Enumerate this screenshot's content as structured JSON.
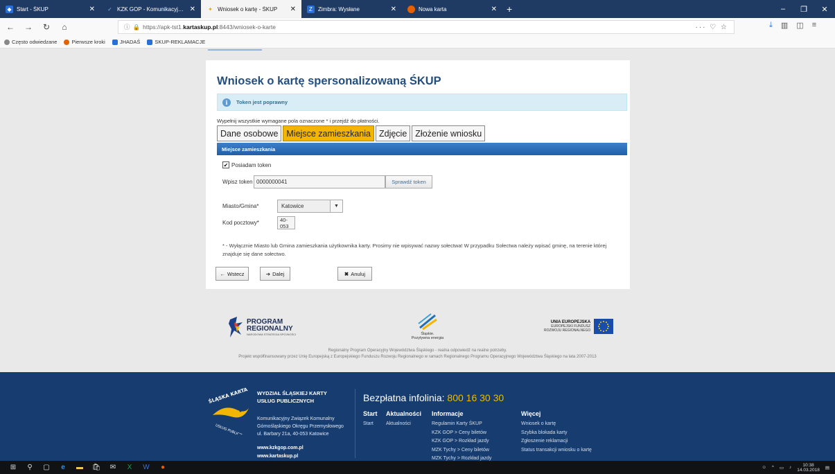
{
  "browser": {
    "tabs": [
      {
        "title": "Start - ŚKUP",
        "icon": "skup-icon",
        "active": false
      },
      {
        "title": "KZK GOP - Komunikacyjny Zw",
        "icon": "kzk-icon",
        "active": false
      },
      {
        "title": "Wniosek o kartę - ŚKUP",
        "icon": "skup-icon",
        "active": true
      },
      {
        "title": "Zimbra: Wysłane",
        "icon": "zimbra-icon",
        "active": false
      },
      {
        "title": "Nowa karta",
        "icon": "firefox-icon",
        "active": false
      }
    ],
    "new_tab": "+",
    "url_prefix": "https://apk-tst1.",
    "url_domain": "kartaskup.pl",
    "url_suffix": ":8443/wniosek-o-karte",
    "url_actions": "··· ♡ ☆",
    "bookmarks": [
      {
        "label": "Często odwiedzane",
        "color": "#888888"
      },
      {
        "label": "Pierwsze kroki",
        "color": "#e66000"
      },
      {
        "label": "JHADAŚ",
        "color": "#2a6fd6"
      },
      {
        "label": "SKUP-REKLAMACJE",
        "color": "#2a6fd6"
      }
    ]
  },
  "form": {
    "title": "Wniosek o kartę spersonalizowaną ŚKUP",
    "alert": "Token jest poprawny",
    "hint": "Wypełnij wszystkie wymagane pola oznaczone * i przejdź do płatności.",
    "steps": [
      {
        "label": "Dane osobowe",
        "active": false
      },
      {
        "label": "Miejsce zamieszkania",
        "active": true
      },
      {
        "label": "Zdjęcie",
        "active": false
      },
      {
        "label": "Złożenie wniosku",
        "active": false
      }
    ],
    "section_title": "Miejsce zamieszkania",
    "has_token_label": "Posiadam token",
    "has_token_checked": true,
    "token_label": "Wpisz token",
    "token_value": "0000000041",
    "check_token_button": "Sprawdź token",
    "city_label": "Miasto/Gmina*",
    "city_value": "Katowice",
    "postal_label": "Kod pocztowy*",
    "postal_value": "40-053",
    "note": "* - Wyłącznie Miasto lub Gmina zamieszkania użytkownika karty. Prosimy nie wpisywać nazwy sołectwa! W przypadku Sołectwa należy wpisać gminę, na terenie której znajduje się dane sołectwo.",
    "back_button": "Wstecz",
    "next_button": "Dalej",
    "cancel_button": "Anuluj"
  },
  "logos": {
    "program_line1": "PROGRAM",
    "program_line2": "REGIONALNY",
    "program_sub": "NARODOWA STRATEGIA SPÓJNOŚCI",
    "slaskie_line1": "Śląskie.",
    "slaskie_line2": "Pozytywna energia",
    "ue_line1": "UNIA EUROPEJSKA",
    "ue_line2": "EUROPEJSKI FUNDUSZ",
    "ue_line3": "ROZWOJU REGIONALNEGO",
    "caption1": "Regionalny Program Operacyjny Województwa Śląskiego - realna odpowiedź na realne potrzeby.",
    "caption2": "Projekt współfinansowany przez Unię Europejską z Europejskiego Funduszu Rozwoju Regionalnego w ramach Regionalnego Programu Operacyjnego Województwa Śląskiego na lata 2007-2013"
  },
  "footer": {
    "logo_text_top": "ŚLĄSKA KARTA",
    "logo_text_bottom": "USŁUG PUBLICZNYCH",
    "org_title1": "WYDZIAŁ ŚLĄSKIEJ KARTY",
    "org_title2": "USŁUG PUBLICZNYCH",
    "addr1": "Komunikacyjny Związek Komunalny",
    "addr2": "Górnośląskiego Okręgu Przemysłowego",
    "addr3": "ul. Barbary 21a, 40-053 Katowice",
    "www1": "www.kzkgop.com.pl",
    "www2": "www.kartaskup.pl",
    "infoline_label": "Bezpłatna infolinia:",
    "infoline_number": "800 16 30 30",
    "columns": [
      {
        "title": "Start",
        "links": [
          "Start"
        ]
      },
      {
        "title": "Aktualności",
        "links": [
          "Aktualności"
        ]
      },
      {
        "title": "Informacje",
        "links": [
          "Regulamin Karty ŚKUP",
          "KZK GOP > Ceny biletów",
          "KZK GOP > Rozkład jazdy",
          "MZK Tychy > Ceny biletów",
          "MZK Tychy > Rozkład jazdy"
        ]
      },
      {
        "title": "Więcej",
        "links": [
          "Wniosek o kartę",
          "Szybka blokada karty",
          "Zgłoszenie reklamacji",
          "Status transakcji wniosku o kartę"
        ]
      }
    ]
  },
  "taskbar": {
    "time": "10:38",
    "date": "14.03.2018"
  }
}
